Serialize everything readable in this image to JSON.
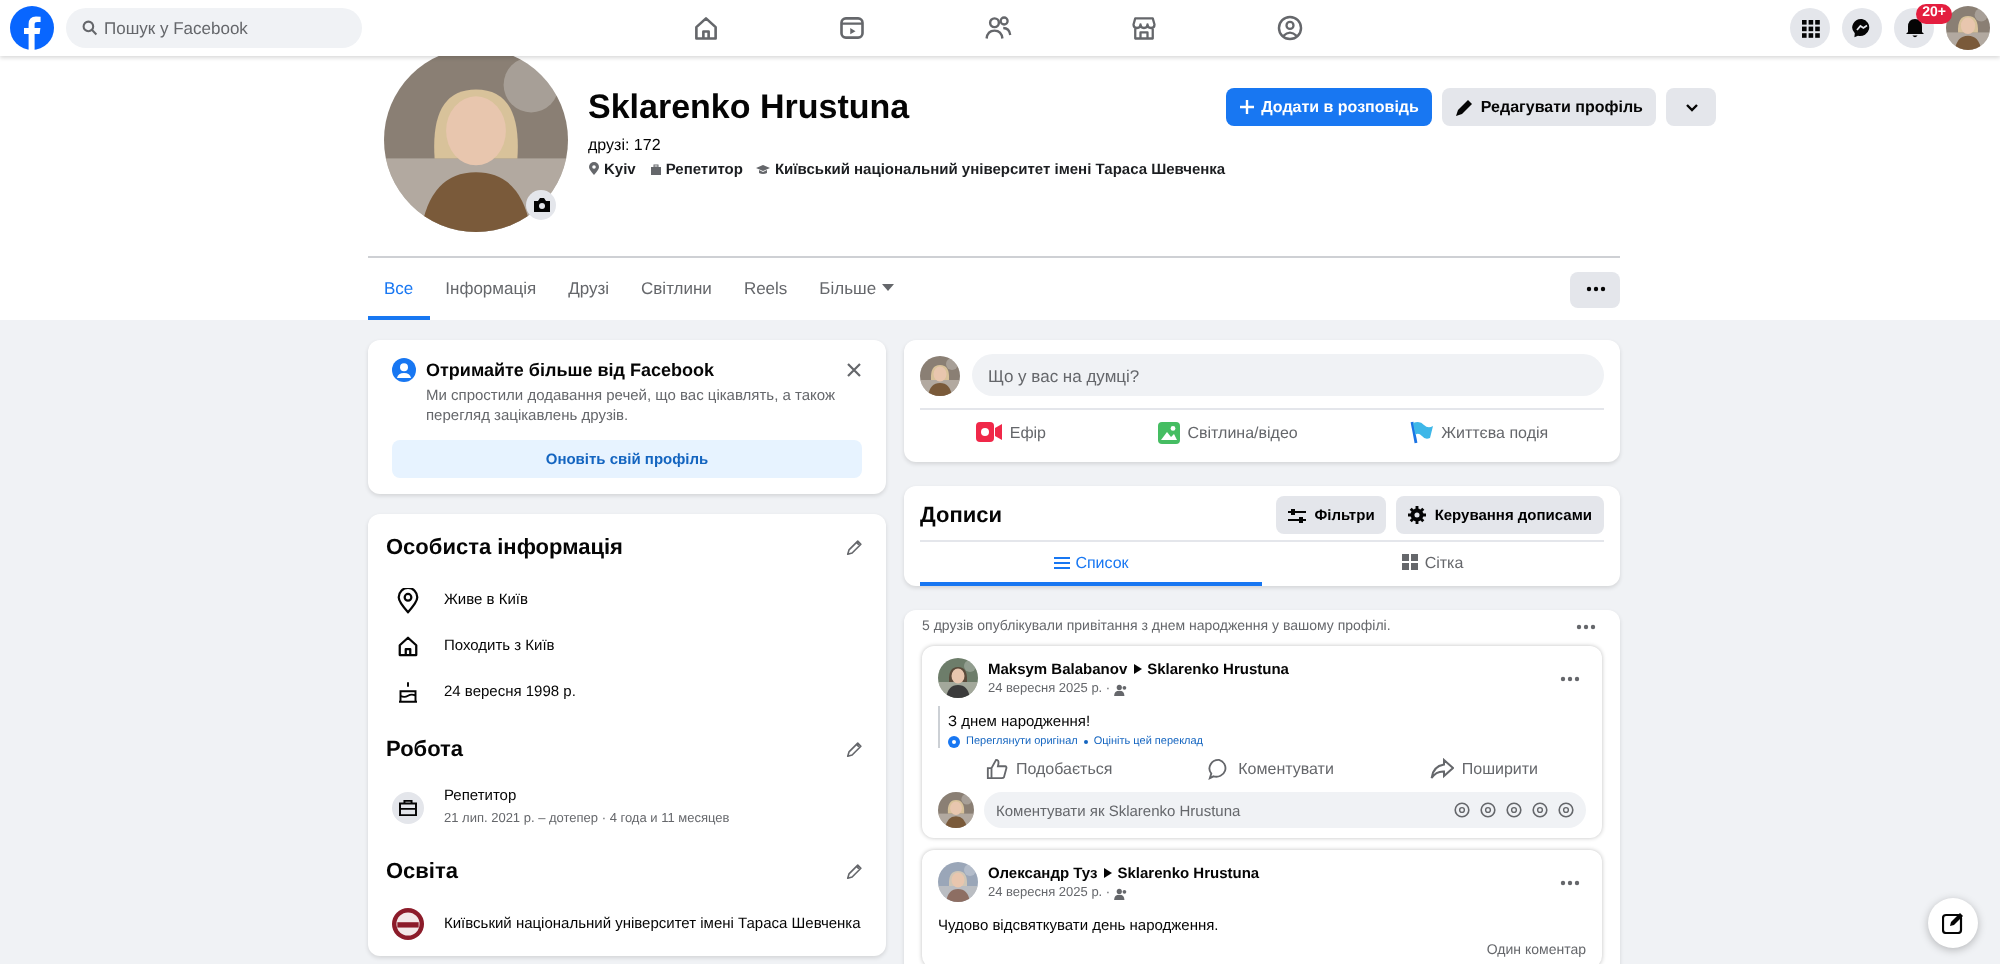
{
  "top_bar": {
    "search": {
      "placeholder": "Пошук у Facebook"
    },
    "notification_badge": "20+"
  },
  "profile": {
    "name": "Sklarenko Hrustuna",
    "friends": "друзі: 172",
    "details": [
      "Kyiv",
      "Репетитор",
      "Київський національний університет імені Тараса Шевченка"
    ],
    "buttons": [
      {
        "label": "Додати в розповідь",
        "kind": "primary"
      },
      {
        "label": "Редагувати профіль",
        "kind": "secondary"
      }
    ]
  },
  "tabs": [
    {
      "label": "Все",
      "selected": true
    },
    {
      "label": "Інформація",
      "selected": false
    },
    {
      "label": "Друзі",
      "selected": false
    },
    {
      "label": "Світлини",
      "selected": false
    },
    {
      "label": "Reels",
      "selected": false
    },
    {
      "label": "Більше",
      "selected": false
    }
  ],
  "promo": {
    "title": "Отримайте більше від Facebook",
    "text": "Ми спростили додавання речей, що вас цікавлять, а також перегляд зацікавлень друзів.",
    "button": "Оновіть свій профіль"
  },
  "about": [
    {
      "title": "Особиста інформація",
      "items": [
        {
          "text": "Живе в Київ"
        },
        {
          "text": "Походить з Київ"
        },
        {
          "text": "24 вересня 1998 р."
        }
      ]
    },
    {
      "title": "Робота",
      "items": [
        {
          "text": "Репетитор",
          "subtext": "21 лип. 2021 р. – дотепер · 4 года и 11 месяцев"
        }
      ]
    },
    {
      "title": "Освіта",
      "items": [
        {
          "text": "Київський національний університет імені Тараса Шевченка"
        }
      ]
    }
  ],
  "composer": {
    "placeholder": "Що у вас на думці?",
    "actions": [
      "Ефір",
      "Світлина/відео",
      "Життєва подія"
    ]
  },
  "posts": {
    "title": "Дописи",
    "buttons": [
      "Фільтри",
      "Керування дописами"
    ],
    "views": [
      {
        "label": "Список",
        "selected": true
      },
      {
        "label": "Сітка",
        "selected": false
      }
    ]
  },
  "birthday": {
    "summary": "5 друзів опублікували привітання з днем народження у вашому профілі.",
    "posts": [
      {
        "author": "Maksym Balabanov",
        "target": "Sklarenko Hrustuna",
        "date": "24 вересня 2025 р. ·",
        "text": "З днем народження!",
        "translation": [
          "Переглянути оригінал",
          "Оцініть цей переклад"
        ],
        "actions": [
          "Подобається",
          "Коментувати",
          "Поширити"
        ],
        "comment_placeholder": "Коментувати як Sklarenko Hrustuna"
      },
      {
        "author": "Олександр Туз",
        "target": "Sklarenko Hrustuna",
        "date": "24 вересня 2025 р. ·",
        "text": "Чудово відсвяткувати день народження.",
        "comment_count": "Один коментар"
      }
    ]
  }
}
